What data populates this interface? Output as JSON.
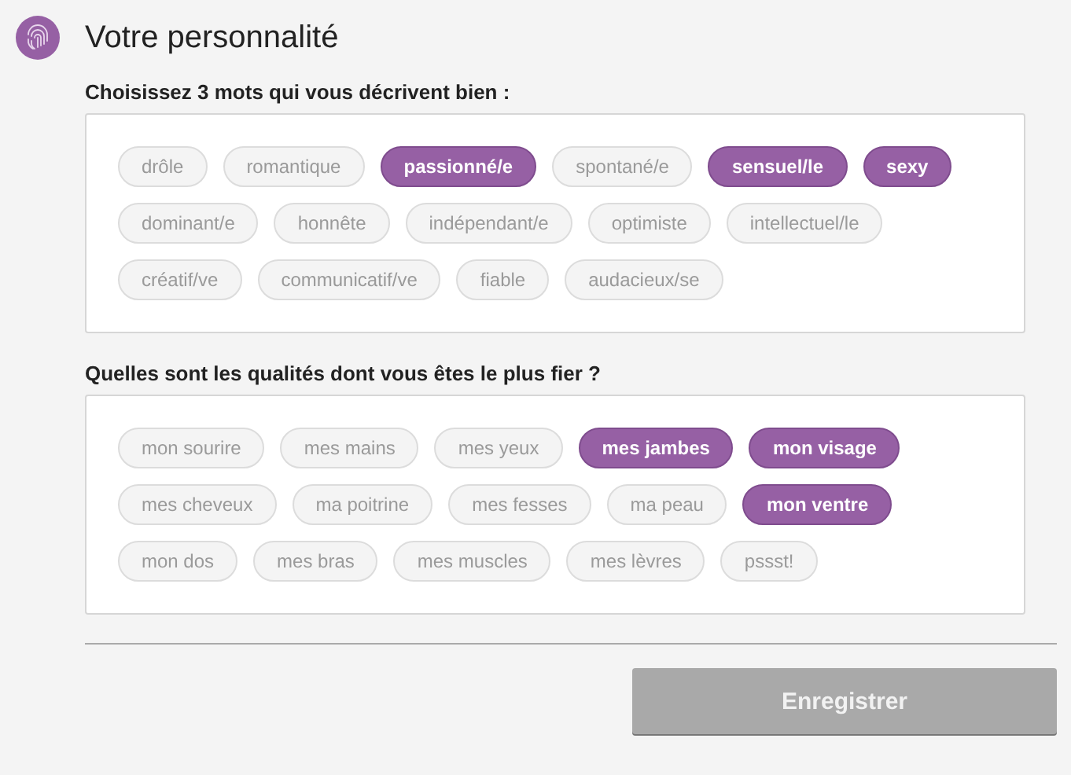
{
  "header": {
    "title": "Votre personnalité"
  },
  "sections": [
    {
      "label": "Choisissez 3 mots qui vous décrivent bien :",
      "chips": [
        {
          "label": "drôle",
          "selected": false
        },
        {
          "label": "romantique",
          "selected": false
        },
        {
          "label": "passionné/e",
          "selected": true
        },
        {
          "label": "spontané/e",
          "selected": false
        },
        {
          "label": "sensuel/le",
          "selected": true
        },
        {
          "label": "sexy",
          "selected": true
        },
        {
          "label": "dominant/e",
          "selected": false
        },
        {
          "label": "honnête",
          "selected": false
        },
        {
          "label": "indépendant/e",
          "selected": false
        },
        {
          "label": "optimiste",
          "selected": false
        },
        {
          "label": "intellectuel/le",
          "selected": false
        },
        {
          "label": "créatif/ve",
          "selected": false
        },
        {
          "label": "communicatif/ve",
          "selected": false
        },
        {
          "label": "fiable",
          "selected": false
        },
        {
          "label": "audacieux/se",
          "selected": false
        }
      ]
    },
    {
      "label": "Quelles sont les qualités dont vous êtes le plus fier ?",
      "chips": [
        {
          "label": "mon sourire",
          "selected": false
        },
        {
          "label": "mes mains",
          "selected": false
        },
        {
          "label": "mes yeux",
          "selected": false
        },
        {
          "label": "mes jambes",
          "selected": true
        },
        {
          "label": "mon visage",
          "selected": true
        },
        {
          "label": "mes cheveux",
          "selected": false
        },
        {
          "label": "ma poitrine",
          "selected": false
        },
        {
          "label": "mes fesses",
          "selected": false
        },
        {
          "label": "ma peau",
          "selected": false
        },
        {
          "label": "mon ventre",
          "selected": true
        },
        {
          "label": "mon dos",
          "selected": false
        },
        {
          "label": "mes bras",
          "selected": false
        },
        {
          "label": "mes muscles",
          "selected": false
        },
        {
          "label": "mes lèvres",
          "selected": false
        },
        {
          "label": "pssst!",
          "selected": false
        }
      ]
    }
  ],
  "save_button": {
    "label": "Enregistrer"
  }
}
